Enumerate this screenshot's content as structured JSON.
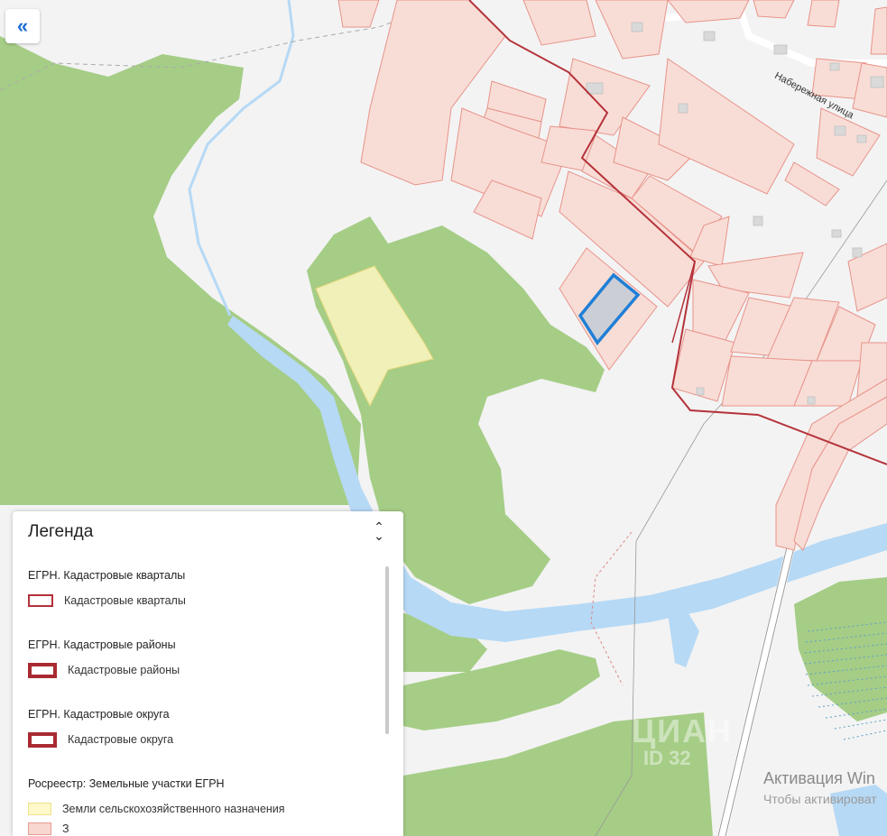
{
  "map": {
    "street_label": "Набережная улица",
    "colors": {
      "forest": "#a5cd86",
      "water": "#b6d9f5",
      "parcel_fill": "#f8ddd6",
      "parcel_stroke": "#e7938a",
      "district_border": "#b5333b",
      "agri_land": "#fdf6c2",
      "selected_parcel": "#1f7fd6"
    }
  },
  "controls": {
    "collapse_icon": "«"
  },
  "legend": {
    "title": "Легенда",
    "toggle_icon": "chevron-up-down-icon",
    "sections": [
      {
        "title": "ЕГРН. Кадастровые кварталы",
        "item_label": "Кадастровые кварталы"
      },
      {
        "title": "ЕГРН. Кадастровые районы",
        "item_label": "Кадастровые районы"
      },
      {
        "title": "ЕГРН. Кадастровые округа",
        "item_label": "Кадастровые округа"
      },
      {
        "title": "Росреестр: Земельные участки ЕГРН",
        "item_label": "Земли сельскохозяйственного назначения",
        "item2_label": "З"
      }
    ]
  },
  "overlays": {
    "watermark_line1": "Активация Win",
    "watermark_line2": "Чтобы активироват",
    "cian_logo": "ЦИАН",
    "cian_id": "ID 32"
  }
}
